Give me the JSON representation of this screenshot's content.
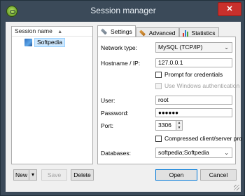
{
  "window": {
    "title": "Session manager",
    "close_glyph": "✕"
  },
  "session_list": {
    "header": "Session name",
    "sort_glyph": "▲",
    "items": [
      {
        "label": "Softpedia",
        "icon": "session-icon"
      }
    ]
  },
  "tabs": [
    {
      "label": "Settings",
      "icon": "wrench-icon",
      "active": true
    },
    {
      "label": "Advanced",
      "icon": "wrench-orange-icon",
      "active": false
    },
    {
      "label": "Statistics",
      "icon": "bar-chart-icon",
      "active": false
    }
  ],
  "settings": {
    "network_type_label": "Network type:",
    "network_type_value": "MySQL (TCP/IP)",
    "hostname_label": "Hostname / IP:",
    "hostname_value": "127.0.0.1",
    "prompt_credentials_label": "Prompt for credentials",
    "prompt_credentials_checked": false,
    "windows_auth_label": "Use Windows authentication",
    "windows_auth_enabled": false,
    "user_label": "User:",
    "user_value": "root",
    "password_label": "Password:",
    "password_value": "●●●●●●",
    "port_label": "Port:",
    "port_value": "3306",
    "compressed_label": "Compressed client/server pro",
    "compressed_checked": false,
    "databases_label": "Databases:",
    "databases_value": "softpedia;Softpedia"
  },
  "buttons": {
    "new": "New",
    "new_dropdown": "▾",
    "save": "Save",
    "delete": "Delete",
    "open": "Open",
    "cancel": "Cancel"
  },
  "dropdown_arrow": "⌄",
  "spin_up": "▲",
  "spin_down": "▼",
  "colors": {
    "title_bar": "#3b4a59",
    "close_button": "#c9302c",
    "selection": "#cde8ff",
    "focus_border": "#0078d7"
  }
}
